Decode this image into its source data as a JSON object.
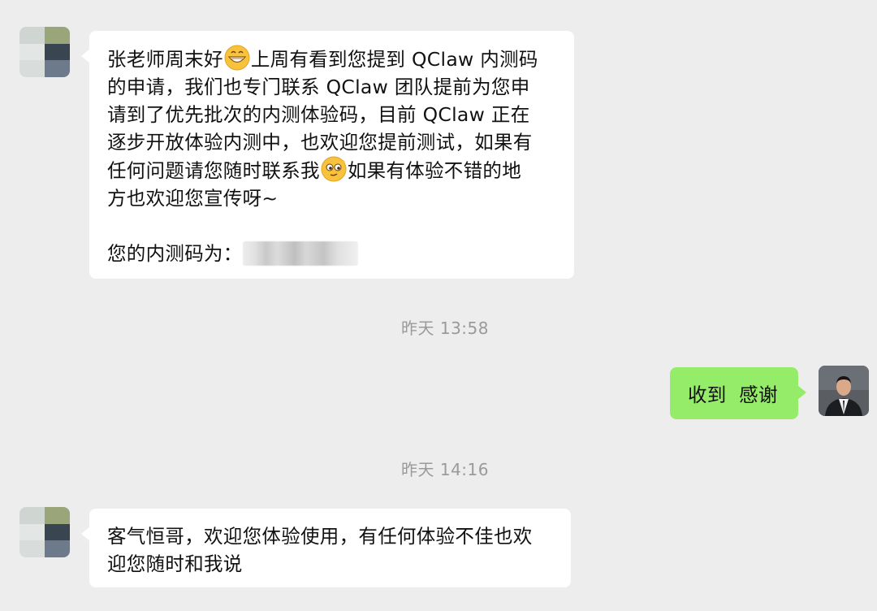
{
  "theme": {
    "background": "#ededed",
    "bubble_sent": "#95ec69",
    "bubble_received": "#ffffff"
  },
  "messages": [
    {
      "sender": "contact",
      "segments": [
        "张老师周末好",
        "grin-emoji",
        "上周有看到您提到 QClaw 内测码",
        "的申请，我们也专门联系 QClaw 团队提前为您申",
        "请到了优先批次的内测体验码，目前 QClaw 正在",
        "逐步开放体验内测中，也欢迎您提前测试，如果有",
        "任何问题请您随时联系我",
        "wink-emoji",
        "如果有体验不错的地",
        "方也欢迎您宣传呀~"
      ],
      "lines": {
        "l1a": "张老师周末好",
        "l1b": "上周有看到您提到 QClaw 内测码",
        "l2": "的申请，我们也专门联系 QClaw 团队提前为您申",
        "l3": "请到了优先批次的内测体验码，目前 QClaw 正在",
        "l4": "逐步开放体验内测中，也欢迎您提前测试，如果有",
        "l5a": "任何问题请您随时联系我",
        "l5b": "如果有体验不错的地",
        "l6": "方也欢迎您宣传呀~",
        "l8": "您的内测码为："
      }
    },
    {
      "timestamp": "昨天 13:58"
    },
    {
      "sender": "me",
      "text": "收到  感谢"
    },
    {
      "timestamp": "昨天 14:16"
    },
    {
      "sender": "contact",
      "lines": {
        "l1": "客气恒哥，欢迎您体验使用，有任何体验不佳也欢",
        "l2": "迎您随时和我说"
      }
    }
  ]
}
